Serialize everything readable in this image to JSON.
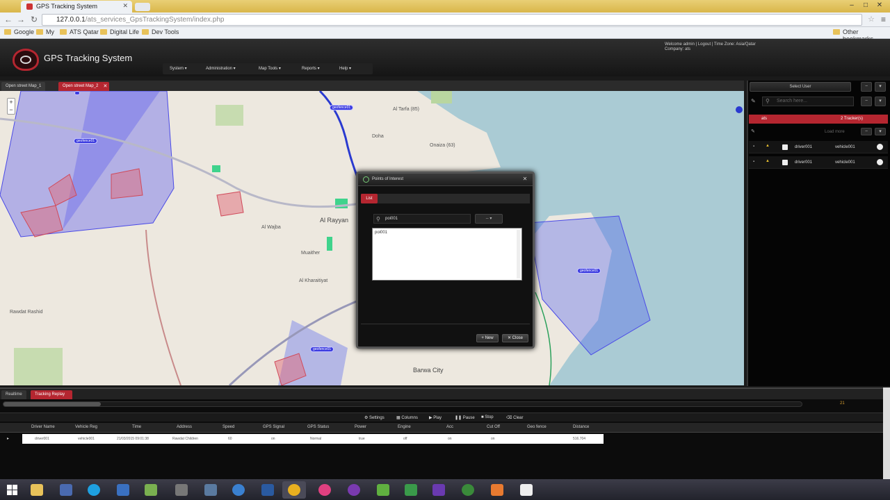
{
  "browser": {
    "tab_title": "GPS Tracking System",
    "url_host": "127.0.0.1",
    "url_path": "/ats_services_GpsTrackingSystem/index.php",
    "bookmarks": [
      "Google",
      "My",
      "ATS Qatar",
      "Digital Life",
      "Dev Tools"
    ],
    "other_bookmarks": "Other bookmarks"
  },
  "app": {
    "title": "GPS Tracking System",
    "welcome_line": "Welcome admin | Logout | Time Zone: Asia/Qatar",
    "company_line": "Company: ats",
    "menu": [
      "System",
      "Administration",
      "Map Tools",
      "Reports",
      "Help"
    ]
  },
  "map_tabs": [
    "Open street Map_1",
    "Open street Map_2"
  ],
  "map": {
    "labels": [
      "Al Wajba",
      "Al Rayyan",
      "Muaither",
      "Barwa City",
      "Rawdat Rashid",
      "Al Tarfa (85)",
      "Onaiza (63)",
      "Doha",
      "Al Kharaitiyat"
    ],
    "marker_label": "geofence01"
  },
  "dialog": {
    "title": "Points of Interest",
    "tab_list": "List",
    "search_value": "poi001",
    "select_value": "--",
    "list_items": [
      "poi001"
    ],
    "new_button": "New",
    "close_button": "Close"
  },
  "right_panel": {
    "select_user": "Select User",
    "search_placeholder": "Search here...",
    "group_name": "ats",
    "group_count": "2 Tracker(s)",
    "load_more": "Load more",
    "trackers": [
      {
        "driver": "driver001",
        "vehicle": "vehicle001"
      },
      {
        "driver": "driver001",
        "vehicle": "vehicle001"
      }
    ]
  },
  "bottom": {
    "tabs": [
      "Realtime",
      "Tracking Replay"
    ],
    "slider_value": "21",
    "controls": [
      "Settings",
      "Columns",
      "Play",
      "Pause",
      "Stop",
      "Clear"
    ],
    "columns": [
      "Driver Name",
      "Vehicle Reg",
      "Time",
      "Address",
      "Speed",
      "GPS Signal",
      "GPS Status",
      "Power",
      "Engine",
      "Acc",
      "Cut Off",
      "Geo fence",
      "Distance"
    ],
    "row": [
      "driver001",
      "vehicle001",
      "21/03/2015 09:01:38",
      "Rawdat Children",
      "60",
      "on",
      "Normal",
      "true",
      "off",
      "on",
      "on",
      "",
      "516.704"
    ]
  }
}
